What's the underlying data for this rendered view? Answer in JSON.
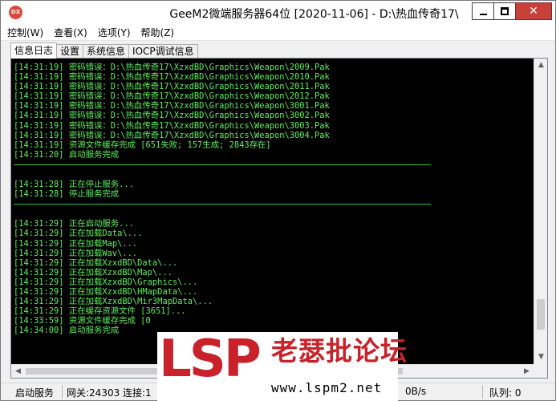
{
  "window": {
    "icon_text": "DX",
    "title": "GeeM2微端服务器64位 [2020-11-06] - D:\\热血传奇17\\",
    "close_glyph": "✕"
  },
  "menu": [
    {
      "label": "控制(W)"
    },
    {
      "label": "查看(X)"
    },
    {
      "label": "选项(Y)"
    },
    {
      "label": "帮助(Z)"
    }
  ],
  "tabs": [
    {
      "label": "信息日志",
      "active": true
    },
    {
      "label": "设置",
      "active": false
    },
    {
      "label": "系统信息",
      "active": false
    },
    {
      "label": "IOCP调试信息",
      "active": false
    }
  ],
  "log": {
    "color": "#5ef05e",
    "block1": [
      "[14:31:19] 密码错误：D:\\热血传奇17\\XzxdBD\\Graphics\\Weapon\\2009.Pak",
      "[14:31:19] 密码错误：D:\\热血传奇17\\XzxdBD\\Graphics\\Weapon\\2010.Pak",
      "[14:31:19] 密码错误：D:\\热血传奇17\\XzxdBD\\Graphics\\Weapon\\2011.Pak",
      "[14:31:19] 密码错误：D:\\热血传奇17\\XzxdBD\\Graphics\\Weapon\\2012.Pak",
      "[14:31:19] 密码错误：D:\\热血传奇17\\XzxdBD\\Graphics\\Weapon\\3001.Pak",
      "[14:31:19] 密码错误：D:\\热血传奇17\\XzxdBD\\Graphics\\Weapon\\3002.Pak",
      "[14:31:19] 密码错误：D:\\热血传奇17\\XzxdBD\\Graphics\\Weapon\\3003.Pak",
      "[14:31:19] 密码错误：D:\\热血传奇17\\XzxdBD\\Graphics\\Weapon\\3004.Pak",
      "[14:31:19] 资源文件缓存完成 [651失败; 157生成; 2843存在]",
      "[14:31:20] 启动服务完成"
    ],
    "block2": [
      "[14:31:28] 正在停止服务...",
      "[14:31:28] 停止服务完成"
    ],
    "block3": [
      "[14:31:29] 正在启动服务...",
      "[14:31:29] 正在加载Data\\...",
      "[14:31:29] 正在加载Map\\...",
      "[14:31:29] 正在加载Wav\\...",
      "[14:31:29] 正在加载XzxdBD\\Data\\...",
      "[14:31:29] 正在加载XzxdBD\\Map\\...",
      "[14:31:29] 正在加载XzxdBD\\Graphics\\...",
      "[14:31:29] 正在加载XzxdBD\\HMapData\\...",
      "[14:31:29] 正在加载XzxdBD\\Mir3MapData\\...",
      "[14:31:29] 正在缓存资源文件 [3651]...",
      "[14:33:59] 资源文件缓存完成 [0",
      "[14:34:00] 启动服务完成"
    ]
  },
  "scrollbars": {
    "up": "▲",
    "down": "▼",
    "left": "◀",
    "right": "▶"
  },
  "status": {
    "service": "启动服务",
    "gateway": "网关:24303",
    "connections": "连接:1",
    "speed": "0B/s",
    "queue": "队列: 0"
  },
  "watermark": {
    "logo": "LSP",
    "site_name": "老瑟批论坛",
    "url": "www.lspm2.net"
  }
}
